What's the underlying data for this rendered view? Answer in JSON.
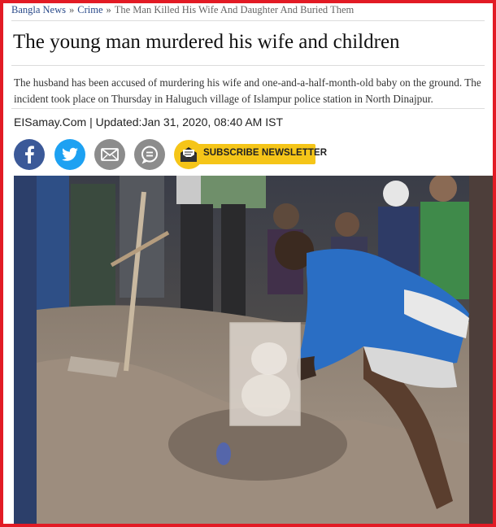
{
  "breadcrumb": {
    "home": "Bangla News",
    "category": "Crime",
    "separator": "»",
    "current": "The Man Killed His Wife And Daughter And Buried Them"
  },
  "article": {
    "title": "The young man murdered his wife and children",
    "summary": "The husband has been accused of murdering his wife and one-and-a-half-month-old baby on the ground. The incident took place on Thursday in Haluguch village of Islampur police station in North Dinajpur.",
    "meta": "EISamay.Com | Updated:Jan 31, 2020, 08:40 AM IST"
  },
  "share": {
    "buttons": [
      {
        "name": "facebook-icon",
        "color": "#3b5998"
      },
      {
        "name": "twitter-icon",
        "color": "#1da1f2"
      },
      {
        "name": "email-icon",
        "color": "#8c8c8c"
      },
      {
        "name": "comment-icon",
        "color": "#8c8c8c"
      }
    ],
    "subscribe_label": "SUBSCRIBE NEWSLETTER"
  },
  "colors": {
    "frame": "#e21b25",
    "subscribe": "#f5c518",
    "link": "#2a4a8a"
  }
}
